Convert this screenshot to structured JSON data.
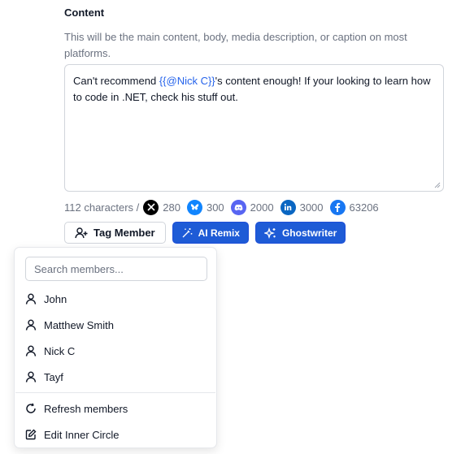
{
  "content": {
    "title": "Content",
    "description": "This will be the main content, body, media description, or caption on most platforms.",
    "text_before": "Can't recommend ",
    "mention": "{{@Nick C}}",
    "text_after": "'s content enough! If your looking to learn how to code in .NET, check his stuff out."
  },
  "counts": {
    "characters": "112 characters /",
    "networks": [
      {
        "name": "x",
        "icon": "x-icon",
        "limit": "280",
        "color": "#000000"
      },
      {
        "name": "bluesky",
        "icon": "bluesky-icon",
        "limit": "300",
        "color": "#1185fe"
      },
      {
        "name": "discord",
        "icon": "discord-icon",
        "limit": "2000",
        "color": "#5865f2"
      },
      {
        "name": "linkedin",
        "icon": "linkedin-icon",
        "limit": "3000",
        "color": "#0a66c2"
      },
      {
        "name": "facebook",
        "icon": "facebook-icon",
        "limit": "63206",
        "color": "#1877f2"
      }
    ]
  },
  "buttons": {
    "tag_member": "Tag Member",
    "ai_remix": "AI Remix",
    "ghostwriter": "Ghostwriter"
  },
  "members_dropdown": {
    "search_placeholder": "Search members...",
    "members": [
      "John",
      "Matthew Smith",
      "Nick C",
      "Tayf"
    ],
    "refresh": "Refresh members",
    "edit": "Edit Inner Circle"
  },
  "colors": {
    "accent": "#1e5bd6",
    "mention": "#2563eb"
  }
}
